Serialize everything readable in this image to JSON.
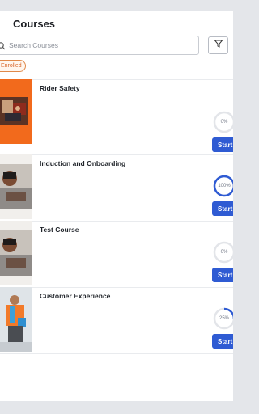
{
  "header": {
    "title": "Courses"
  },
  "search": {
    "placeholder": "Search Courses",
    "value": ""
  },
  "filter": {
    "icon": "filter-icon"
  },
  "chips": {
    "enrolled_label": "Enrolled"
  },
  "courses": [
    {
      "title": "Rider Safety",
      "progress_label": "0%",
      "progress": 0,
      "start_label": "Start"
    },
    {
      "title": "Induction and Onboarding",
      "progress_label": "100%",
      "progress": 100,
      "start_label": "Start"
    },
    {
      "title": "Test Course",
      "progress_label": "0%",
      "progress": 0,
      "start_label": "Start"
    },
    {
      "title": "Customer Experience",
      "progress_label": "25%",
      "progress": 25,
      "start_label": "Start"
    }
  ],
  "colors": {
    "accent": "#2f5bd3",
    "chip_border": "#e0894a",
    "chip_text": "#d8662a",
    "thumb_orange": "#f26a1c",
    "ring_track": "#e3e5e9"
  }
}
